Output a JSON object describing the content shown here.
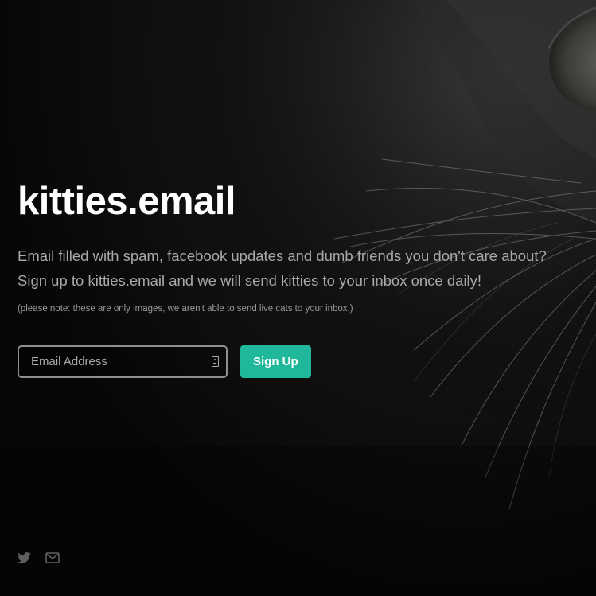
{
  "site": {
    "title": "kitties.email",
    "tagline_line1": "Email filled with spam, facebook updates and dumb friends you don't care about?",
    "tagline_line2": "Sign up to kitties.email and we will send kitties to your inbox once daily!",
    "note": "(please note: these are only images, we aren't able to send live cats to your inbox.)"
  },
  "signup": {
    "email_placeholder": "Email Address",
    "email_value": "",
    "button_label": "Sign Up"
  },
  "footer": {
    "icons": [
      "twitter-icon",
      "envelope-icon"
    ]
  },
  "colors": {
    "accent": "#1fb89a",
    "background": "#060606",
    "title": "#ffffff",
    "text": "#a9a9a9"
  }
}
